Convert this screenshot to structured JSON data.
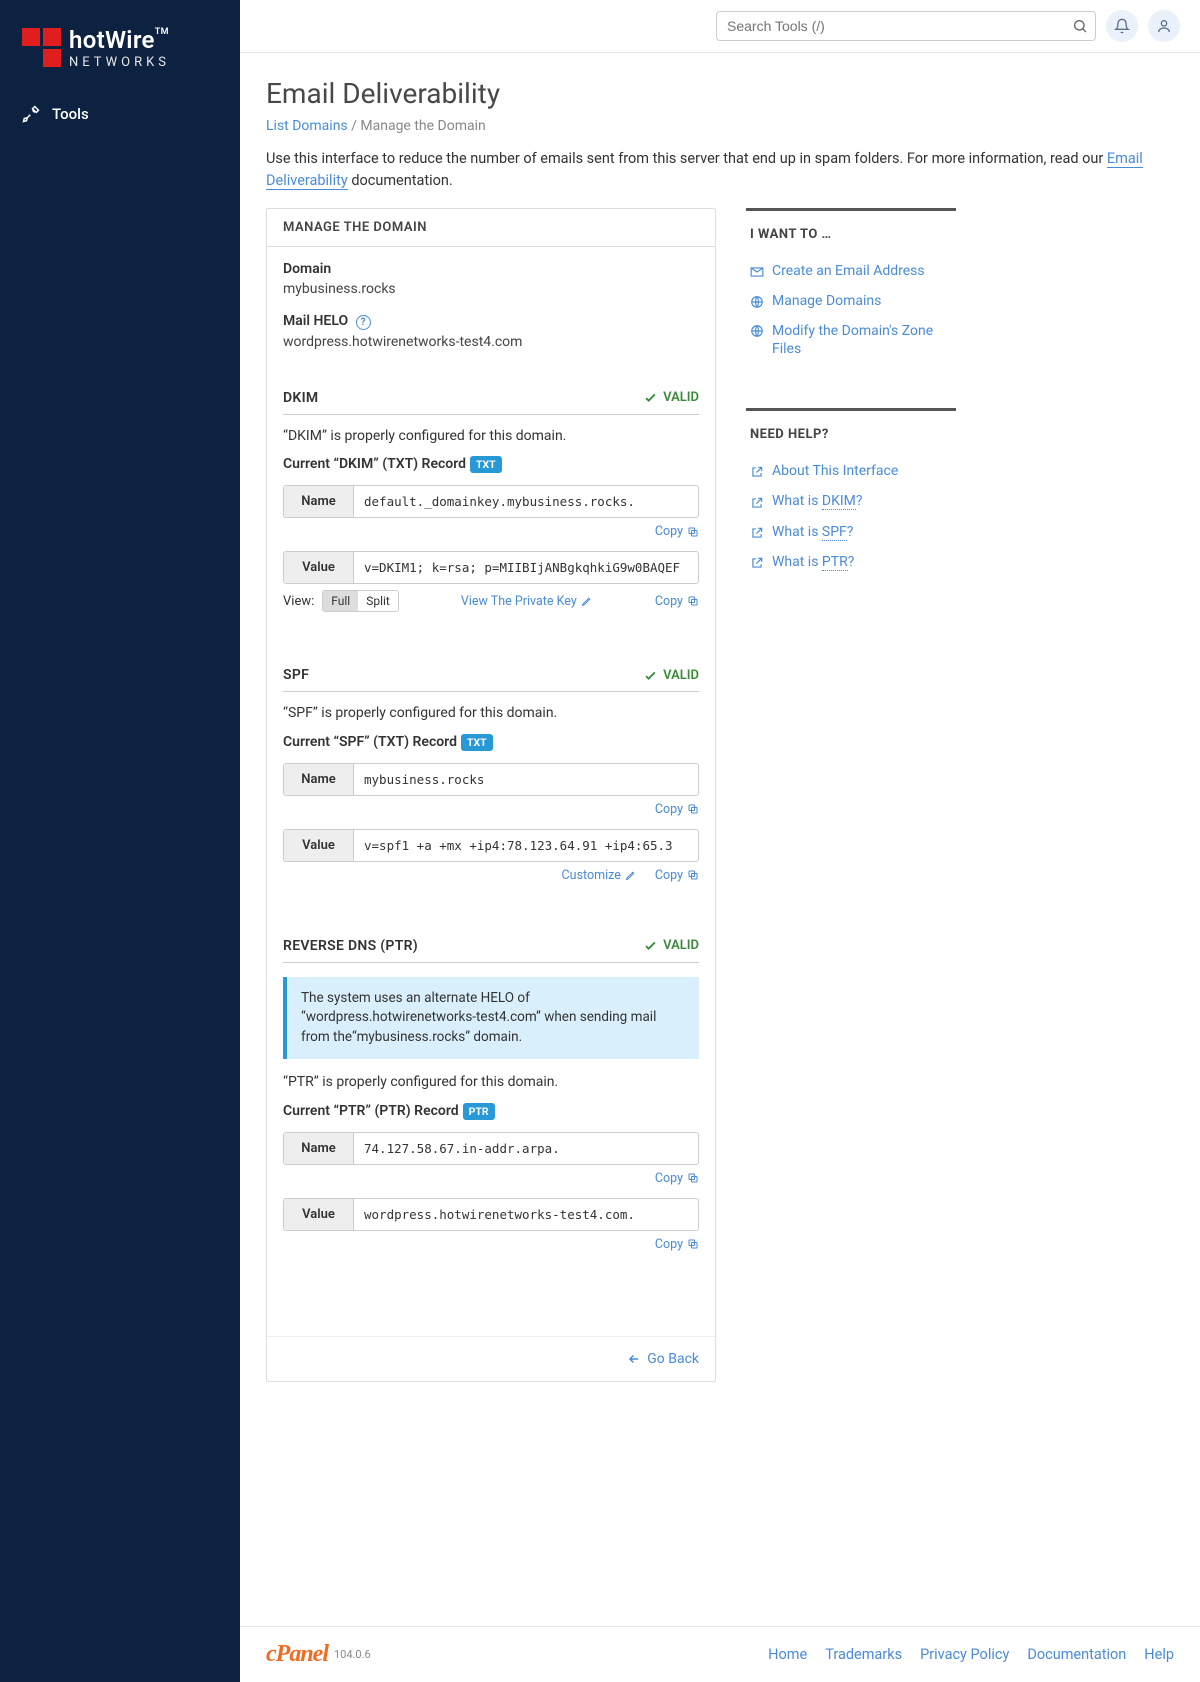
{
  "brand": {
    "name": "hotWire",
    "tm": "TM",
    "sub": "NETWORKS"
  },
  "nav": {
    "tools": "Tools"
  },
  "search": {
    "placeholder": "Search Tools (/)"
  },
  "page": {
    "title": "Email Deliverability",
    "breadcrumb": {
      "list": "List Domains",
      "sep": "/",
      "current": "Manage the Domain"
    },
    "intro_pre": "Use this interface to reduce the number of emails sent from this server that end up in spam folders. For more information, read our ",
    "intro_link": "Email Deliverability",
    "intro_post": " documentation."
  },
  "panel": {
    "header": "Manage the Domain",
    "domain_label": "Domain",
    "domain_value": "mybusiness.rocks",
    "helo_label": "Mail HELO",
    "helo_value": "wordpress.hotwirenetworks-test4.com",
    "valid": "VALID",
    "name_label": "Name",
    "value_label": "Value",
    "copy": "Copy",
    "view_label": "View:",
    "full": "Full",
    "split": "Split",
    "view_private_key": "View The Private Key",
    "customize": "Customize",
    "go_back": "Go Back",
    "txt_tag": "TXT",
    "ptr_tag": "PTR"
  },
  "dkim": {
    "title": "DKIM",
    "desc": "“DKIM” is properly configured for this domain.",
    "current": "Current “DKIM” (TXT) Record",
    "name": "default._domainkey.mybusiness.rocks.",
    "value": "v=DKIM1; k=rsa; p=MIIBIjANBgkqhkiG9w0BAQEF"
  },
  "spf": {
    "title": "SPF",
    "desc": "“SPF” is properly configured for this domain.",
    "current": "Current “SPF” (TXT) Record",
    "name": "mybusiness.rocks",
    "value": "v=spf1 +a +mx +ip4:78.123.64.91 +ip4:65.3"
  },
  "ptr": {
    "title": "Reverse DNS (PTR)",
    "info": "The system uses an alternate HELO of “wordpress.hotwirenetworks-test4.com” when sending mail from the“mybusiness.rocks” domain.",
    "desc": "“PTR” is properly configured for this domain.",
    "current": "Current “PTR” (PTR) Record",
    "name": "74.127.58.67.in-addr.arpa.",
    "value": "wordpress.hotwirenetworks-test4.com."
  },
  "want": {
    "title": "I want to …",
    "create": "Create an Email Address",
    "manage": "Manage Domains",
    "zone": "Modify the Domain's Zone Files"
  },
  "help": {
    "title": "Need Help?",
    "about": "About This Interface",
    "dkim_pre": "What is ",
    "dkim_u": "DKIM",
    "spf_pre": "What is ",
    "spf_u": "SPF",
    "ptr_pre": "What is ",
    "ptr_u": "PTR",
    "q": "?"
  },
  "footer": {
    "cpanel": "cPanel",
    "version": "104.0.6",
    "links": {
      "home": "Home",
      "trademarks": "Trademarks",
      "privacy": "Privacy Policy",
      "docs": "Documentation",
      "help": "Help"
    }
  }
}
